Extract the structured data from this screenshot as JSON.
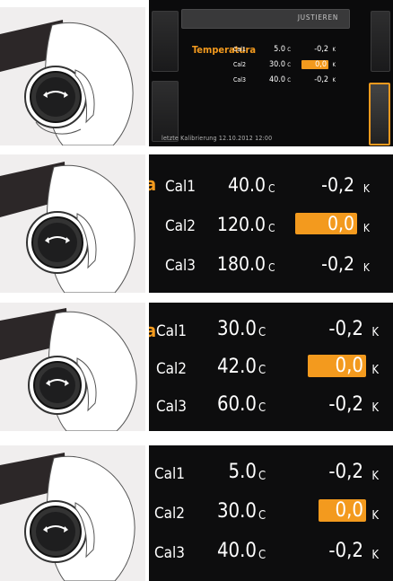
{
  "screens": [
    {
      "header_title": "JUSTIEREN",
      "parameter_label": "Temperatura",
      "rows": [
        {
          "name": "Cal1",
          "temp": "5.0",
          "temp_unit": "C",
          "offset": "-0,2",
          "offset_unit": "K",
          "selected": false
        },
        {
          "name": "Cal2",
          "temp": "30.0",
          "temp_unit": "C",
          "offset": "0,0",
          "offset_unit": "K",
          "selected": true
        },
        {
          "name": "Cal3",
          "temp": "40.0",
          "temp_unit": "C",
          "offset": "-0,2",
          "offset_unit": "K",
          "selected": false
        }
      ],
      "footer": "letzte Kalibrierung 12.10.2012   12:00"
    },
    {
      "cut_label": "a",
      "rows": [
        {
          "name": "Cal1",
          "temp": "40.0",
          "temp_unit": "C",
          "offset": "-0,2",
          "offset_unit": "K",
          "selected": false
        },
        {
          "name": "Cal2",
          "temp": "120.0",
          "temp_unit": "C",
          "offset": "0,0",
          "offset_unit": "K",
          "selected": true
        },
        {
          "name": "Cal3",
          "temp": "180.0",
          "temp_unit": "C",
          "offset": "-0,2",
          "offset_unit": "K",
          "selected": false
        }
      ]
    },
    {
      "cut_label": "a",
      "rows": [
        {
          "name": "Cal1",
          "temp": "30.0",
          "temp_unit": "C",
          "offset": "-0,2",
          "offset_unit": "K",
          "selected": false
        },
        {
          "name": "Cal2",
          "temp": "42.0",
          "temp_unit": "C",
          "offset": "0,0",
          "offset_unit": "K",
          "selected": true
        },
        {
          "name": "Cal3",
          "temp": "60.0",
          "temp_unit": "C",
          "offset": "-0,2",
          "offset_unit": "K",
          "selected": false
        }
      ]
    },
    {
      "rows": [
        {
          "name": "Cal1",
          "temp": "5.0",
          "temp_unit": "C",
          "offset": "-0,2",
          "offset_unit": "K",
          "selected": false
        },
        {
          "name": "Cal2",
          "temp": "30.0",
          "temp_unit": "C",
          "offset": "0,0",
          "offset_unit": "K",
          "selected": true
        },
        {
          "name": "Cal3",
          "temp": "40.0",
          "temp_unit": "C",
          "offset": "-0,2",
          "offset_unit": "K",
          "selected": false
        }
      ]
    }
  ],
  "icons": {
    "rotary_knob": "rotary-knob-icon",
    "hand": "hand-icon"
  },
  "colors": {
    "accent": "#f39a1e",
    "screen_bg": "#0d0d0e",
    "illustration_bg": "#f0eeee"
  }
}
